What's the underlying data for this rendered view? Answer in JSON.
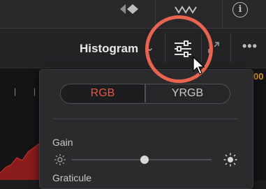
{
  "topbar": {
    "clip_icon": "clip-icon",
    "mid_icon": "waveform-icon",
    "info_glyph": "i"
  },
  "header": {
    "title": "Histogram",
    "chevron": "⌄",
    "more": "•••"
  },
  "scope": {
    "value_label": "00"
  },
  "popup": {
    "mode_options": [
      "RGB",
      "YRGB"
    ],
    "mode_selected": "RGB",
    "gain_label": "Gain",
    "gain_value": 0.52,
    "graticule_label": "Graticule"
  },
  "colors": {
    "accent": "#e8553f",
    "highlight_ring": "#e8644f",
    "scope_mark": "#d69a27"
  }
}
